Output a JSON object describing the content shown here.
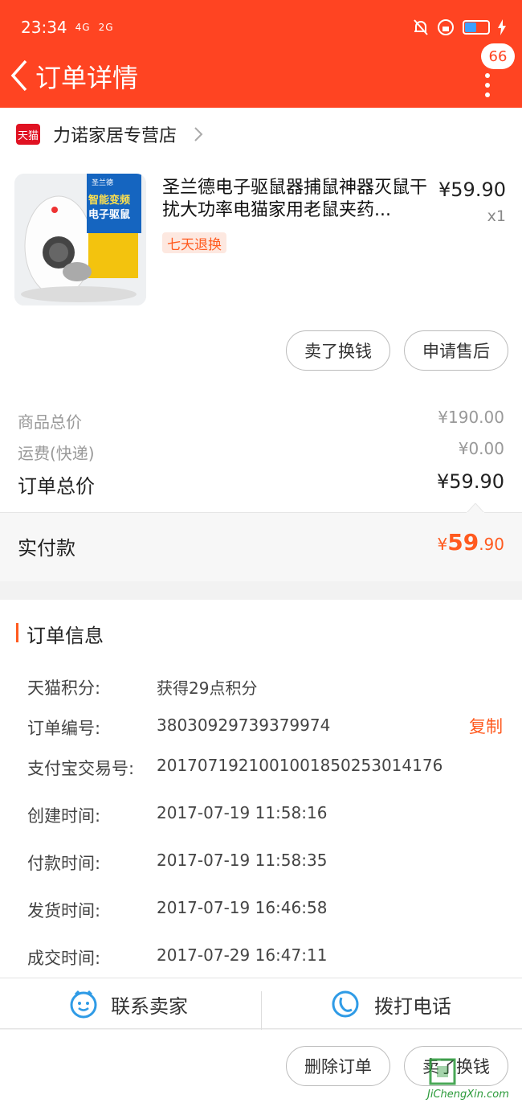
{
  "status_bar": {
    "time": "23:34",
    "signal_1": "4G",
    "signal_2": "2G"
  },
  "nav": {
    "title": "订单详情",
    "badge_count": "66"
  },
  "store": {
    "platform_icon": "天猫",
    "name": "力诺家居专营店"
  },
  "product": {
    "title": "圣兰德电子驱鼠器捕鼠神器灭鼠干扰大功率电猫家用老鼠夹药...",
    "price": "¥59.90",
    "quantity": "x1",
    "tag": "七天退换",
    "image_text_brand": "圣兰德",
    "image_text_line1": "智能变频",
    "image_text_line2": "电子驱鼠"
  },
  "product_actions": {
    "sell_button": "卖了换钱",
    "after_sale_button": "申请售后"
  },
  "fees": {
    "goods_total_label": "商品总价",
    "goods_total_value": "¥190.00",
    "shipping_label": "运费(快递)",
    "shipping_value": "¥0.00",
    "order_total_label": "订单总价",
    "order_total_value": "¥59.90"
  },
  "paid": {
    "label": "实付款",
    "currency": "¥",
    "integer": "59",
    "decimal": ".90"
  },
  "order_info": {
    "title": "订单信息",
    "rows": [
      {
        "label": "天猫积分:",
        "value": "获得29点积分"
      },
      {
        "label": "订单编号:",
        "value": "38030929739379974"
      },
      {
        "label": "支付宝交易号:",
        "value": "2017071921001001850253014176"
      },
      {
        "label": "创建时间:",
        "value": "2017-07-19 11:58:16"
      },
      {
        "label": "付款时间:",
        "value": "2017-07-19 11:58:35"
      },
      {
        "label": "发货时间:",
        "value": "2017-07-19 16:46:58"
      },
      {
        "label": "成交时间:",
        "value": "2017-07-29 16:47:11"
      }
    ],
    "copy_label": "复制"
  },
  "contact": {
    "seller_label": "联系卖家",
    "phone_label": "拨打电话"
  },
  "bottom_actions": {
    "delete_button": "删除订单",
    "sell_button": "卖了换钱"
  },
  "watermark": {
    "text": "JiChengXin.com"
  },
  "colors": {
    "header": "#ff4422",
    "accent": "#ff5a1f",
    "icon_blue": "#2f9be6"
  }
}
